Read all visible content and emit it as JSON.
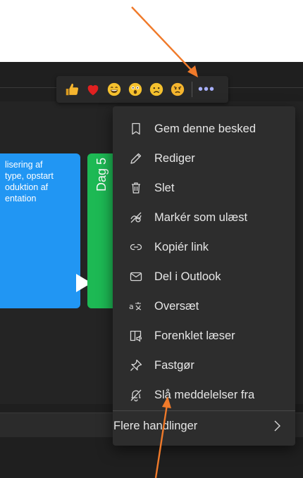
{
  "reactions": [
    {
      "name": "like",
      "icon": "thumbs-up-icon"
    },
    {
      "name": "heart",
      "icon": "heart-icon"
    },
    {
      "name": "laugh",
      "icon": "laugh-icon"
    },
    {
      "name": "surprised",
      "icon": "surprised-icon"
    },
    {
      "name": "sad",
      "icon": "sad-icon"
    },
    {
      "name": "angry",
      "icon": "angry-icon"
    }
  ],
  "reaction_bar": {
    "more_label": "•••"
  },
  "menu": {
    "items": [
      {
        "label": "Gem denne besked",
        "icon": "bookmark-icon"
      },
      {
        "label": "Rediger",
        "icon": "pencil-icon"
      },
      {
        "label": "Slet",
        "icon": "trash-icon"
      },
      {
        "label": "Markér som ulæst",
        "icon": "unread-icon"
      },
      {
        "label": "Kopiér link",
        "icon": "link-icon"
      },
      {
        "label": "Del i Outlook",
        "icon": "mail-icon"
      },
      {
        "label": "Oversæt",
        "icon": "translate-icon"
      },
      {
        "label": "Forenklet læser",
        "icon": "immersive-reader-icon"
      },
      {
        "label": "Fastgør",
        "icon": "pin-icon"
      },
      {
        "label": "Slå meddelelser fra",
        "icon": "bell-off-icon"
      }
    ],
    "more_actions": "Flere handlinger"
  },
  "background": {
    "slide_text": "lisering af\ntype, opstart\noduktion af\nentation",
    "day_label": "Dag 5"
  },
  "colors": {
    "menu_bg": "#2d2d2d",
    "app_bg": "#1f1f1f",
    "accent": "#a8b0ff",
    "annotation_arrow": "#f07a2a",
    "slide_blue": "#2196f3",
    "slide_green": "#1db954"
  }
}
